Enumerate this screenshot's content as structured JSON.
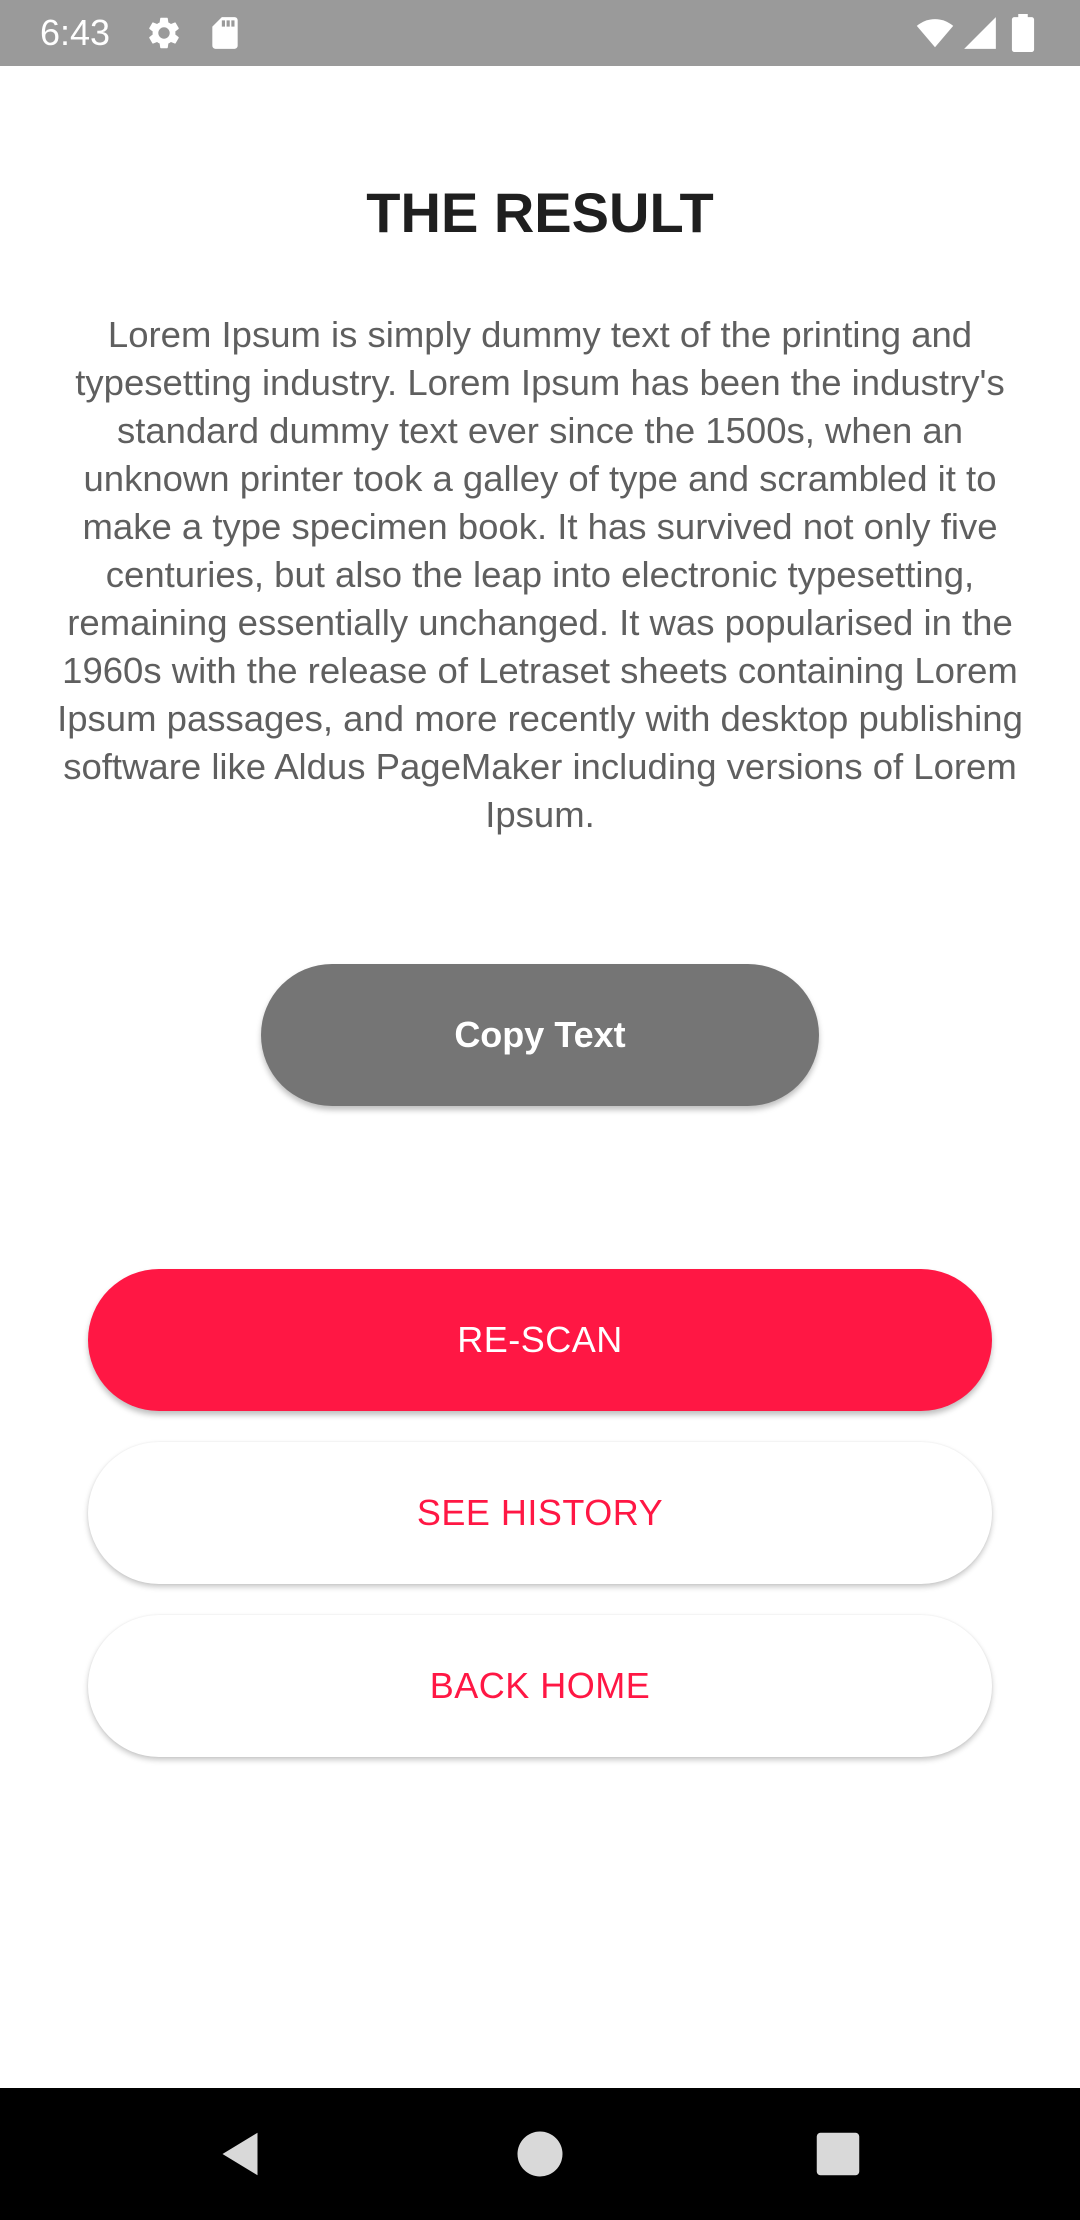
{
  "status_bar": {
    "time": "6:43",
    "left_icons": [
      "gear-icon",
      "sd-card-icon"
    ],
    "right_icons": [
      "wifi-icon",
      "cell-signal-icon",
      "battery-icon"
    ],
    "background": "#9a9a9a"
  },
  "page": {
    "title": "THE RESULT",
    "body": "Lorem Ipsum is simply dummy text of the printing and typesetting industry. Lorem Ipsum has been the industry's standard dummy text ever since the 1500s, when an unknown printer took a galley of type and scrambled it to make a type specimen book. It has survived not only five centuries, but also the leap into electronic typesetting, remaining essentially unchanged. It was popularised in the 1960s with the release of Letraset sheets containing Lorem Ipsum passages, and more recently with desktop publishing software like Aldus PageMaker including versions of Lorem Ipsum."
  },
  "buttons": {
    "copy_text": "Copy Text",
    "rescan": "RE-SCAN",
    "see_history": "SEE HISTORY",
    "back_home": "BACK HOME"
  },
  "nav_bar": {
    "icons": [
      "back-triangle-icon",
      "home-circle-icon",
      "recents-square-icon"
    ]
  },
  "colors": {
    "accent": "#ff1744",
    "copy_button": "#757575",
    "title_text": "#1f1f1f",
    "body_text": "#5f5f5f",
    "nav_bar": "#000000"
  }
}
